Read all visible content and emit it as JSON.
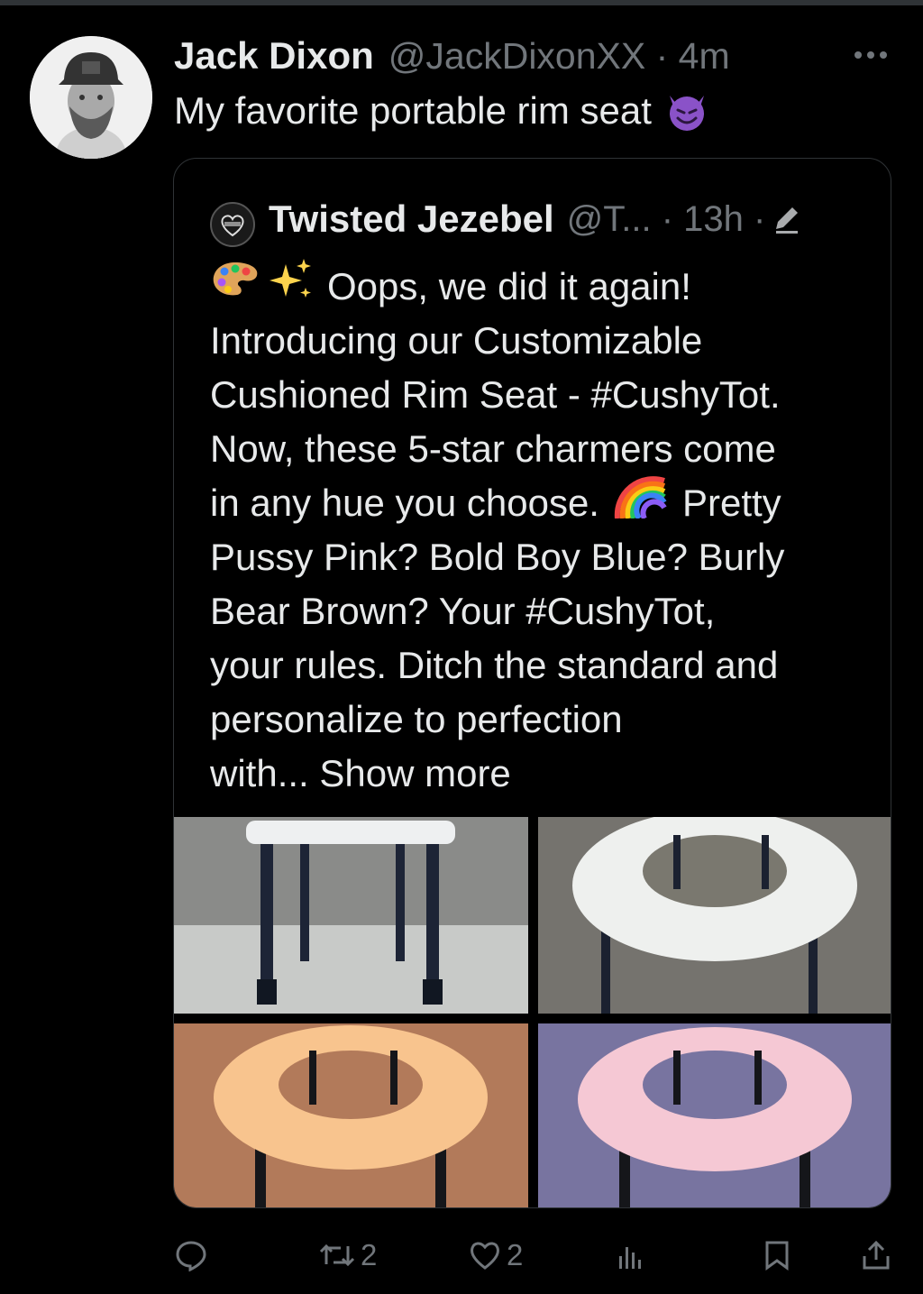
{
  "tweet": {
    "author_name": "Jack Dixon",
    "author_meta": "@JackDixonXX · 4m",
    "text": "My favorite portable rim seat",
    "emoji": "smiling-devil-icon"
  },
  "quote": {
    "author_name": "Twisted Jezebel",
    "author_meta": "@T... · 13h ·",
    "lines": [
      "Oops, we did it again!",
      "Introducing our Customizable",
      "Cushioned Rim Seat - #CushyTot.",
      "Now, these 5-star charmers come",
      "in any hue you choose.",
      "Pretty",
      "Pussy Pink? Bold Boy Blue? Burly",
      "Bear Brown? Your #CushyTot,",
      "your rules. Ditch the standard and",
      "personalize to perfection",
      "with... Show more"
    ]
  },
  "actions": {
    "reply_count": "",
    "retweet_count": "2",
    "like_count": "2"
  },
  "colors": {
    "background": "#000000",
    "text": "#e7e9ea",
    "muted": "#71767b",
    "border": "#2f3336"
  }
}
